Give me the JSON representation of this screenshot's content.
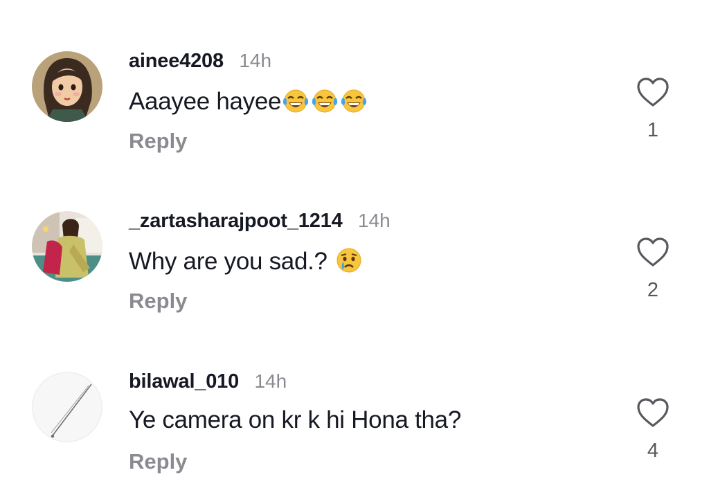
{
  "comments": [
    {
      "username": "ainee4208",
      "time": "14h",
      "text": "Aaayee hayee",
      "emojis": [
        "face-with-tears-of-joy",
        "face-with-tears-of-joy",
        "face-with-tears-of-joy"
      ],
      "reply_label": "Reply",
      "likes": "1",
      "avatar": "illustrated-girl-avatar"
    },
    {
      "username": "_zartasharajpoot_1214",
      "time": "14h",
      "text": "Why are you sad.?",
      "emojis": [
        "crying-face"
      ],
      "reply_label": "Reply",
      "likes": "2",
      "avatar": "photo-avatar"
    },
    {
      "username": "bilawal_010",
      "time": "14h",
      "text": "Ye camera on kr k hi Hona tha?",
      "emojis": [],
      "reply_label": "Reply",
      "likes": "4",
      "avatar": "sketch-avatar"
    }
  ],
  "colors": {
    "username": "#161823",
    "secondary_text": "#8a8b91",
    "like_count": "#58595f",
    "heart_outline": "#58595f"
  }
}
